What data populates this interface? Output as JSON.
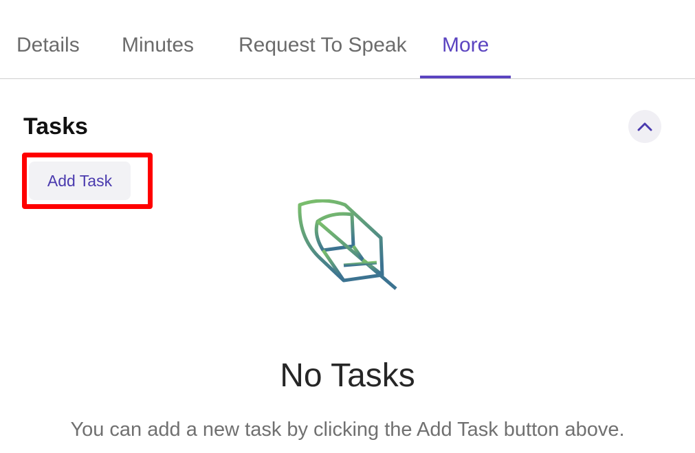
{
  "tabs": [
    {
      "label": "Details",
      "active": false
    },
    {
      "label": "Minutes",
      "active": false
    },
    {
      "label": "Request To Speak",
      "active": false
    },
    {
      "label": "More",
      "active": true
    }
  ],
  "tasks": {
    "title": "Tasks",
    "add_button_label": "Add Task",
    "collapse_icon": "chevron-up-icon",
    "empty_icon": "leaf-icon",
    "empty_title": "No Tasks",
    "empty_message": "You can add a new task by clicking the Add Task button above."
  },
  "colors": {
    "accent": "#5b44c0",
    "highlight": "#ff0000",
    "leaf_gradient_top": "#7cc06a",
    "leaf_gradient_bottom": "#3c7391"
  }
}
